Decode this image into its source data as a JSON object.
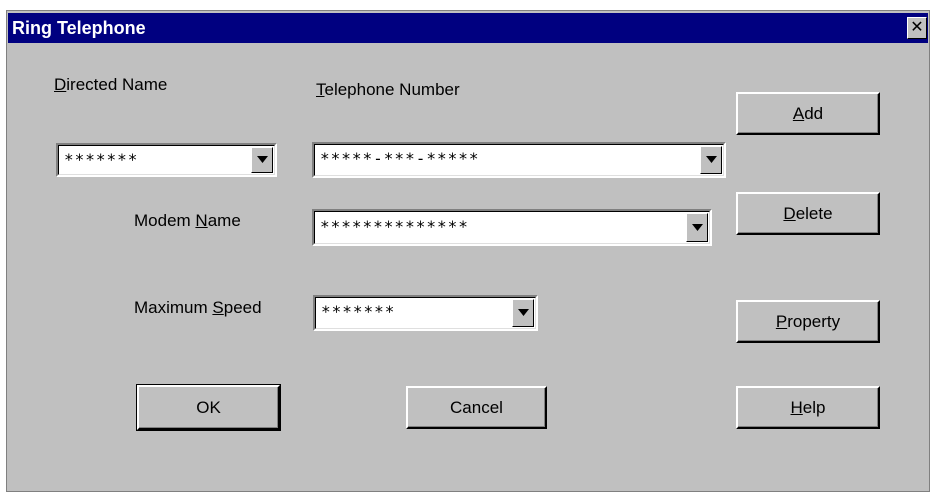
{
  "window": {
    "title": "Ring Telephone",
    "close_symbol": "✕"
  },
  "fields": {
    "directed_name": {
      "label_pre": "",
      "label_key": "D",
      "label_post": "irected Name",
      "value": "*******"
    },
    "telephone_number": {
      "label_pre": "",
      "label_key": "T",
      "label_post": "elephone Number",
      "value": "*****-***-*****"
    },
    "modem_name": {
      "label_pre": "Modem ",
      "label_key": "N",
      "label_post": "ame",
      "value": "**************"
    },
    "maximum_speed": {
      "label_pre": "Maximum ",
      "label_key": "S",
      "label_post": "peed",
      "value": "*******"
    }
  },
  "buttons": {
    "add": {
      "pre": "",
      "key": "A",
      "post": "dd"
    },
    "delete": {
      "pre": "",
      "key": "D",
      "post": "elete"
    },
    "property": {
      "pre": "",
      "key": "P",
      "post": "roperty"
    },
    "ok": {
      "label": "OK"
    },
    "cancel": {
      "label": "Cancel"
    },
    "help": {
      "pre": "",
      "key": "H",
      "post": "elp"
    }
  },
  "icons": {
    "close": "close-icon",
    "dropdown": "chevron-down-icon"
  },
  "colors": {
    "title_bar": "#000080",
    "face": "#c0c0c0",
    "field": "#ffffff"
  }
}
